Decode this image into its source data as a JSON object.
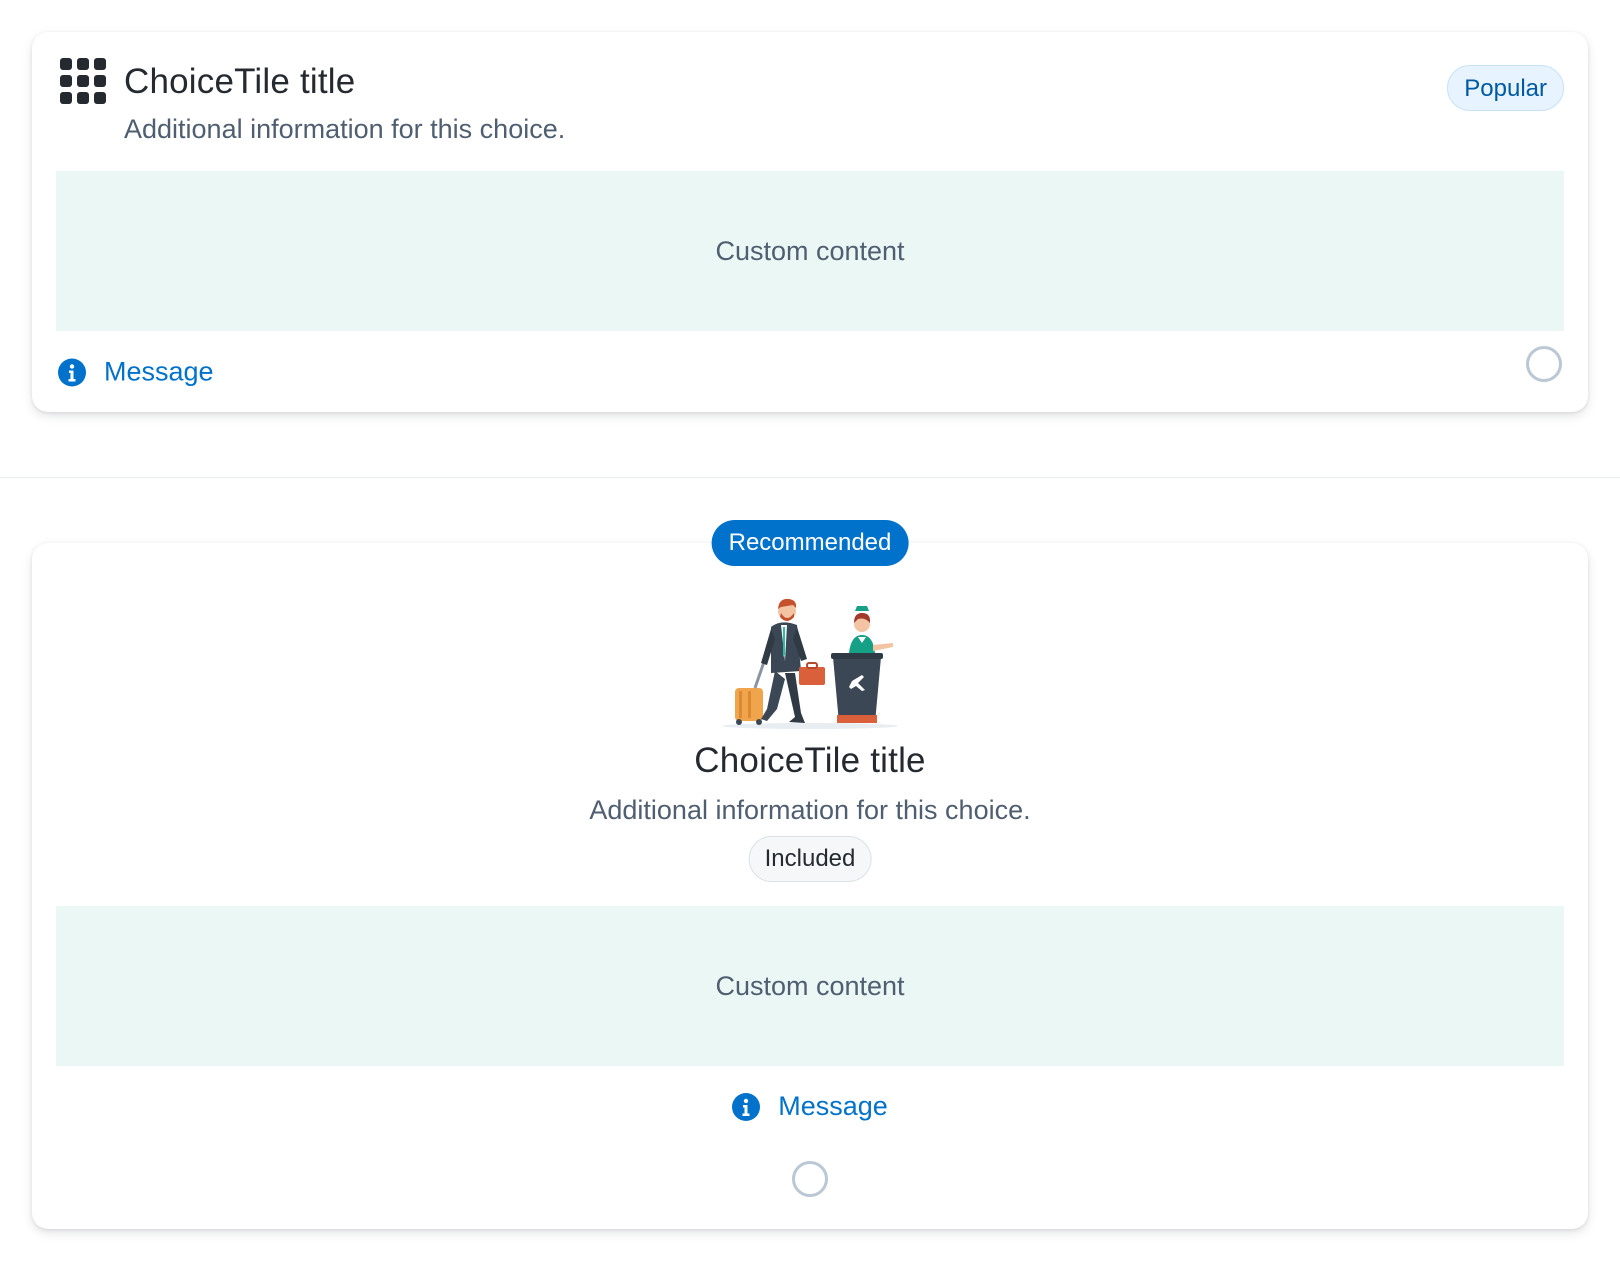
{
  "tile_top": {
    "icon": "apps-grid-icon",
    "title": "ChoiceTile title",
    "description": "Additional information for this choice.",
    "badge": "Popular",
    "custom_content": "Custom content",
    "message": "Message",
    "message_icon": "info-icon",
    "selected": false
  },
  "tile_bottom": {
    "badge": "Recommended",
    "illustration": "airport-check-in-illustration",
    "title": "ChoiceTile title",
    "description": "Additional information for this choice.",
    "tag": "Included",
    "custom_content": "Custom content",
    "message": "Message",
    "message_icon": "info-icon",
    "selected": false
  },
  "colors": {
    "primary": "#0172cb",
    "popular_badge_bg": "#e7f3ff",
    "custom_content_bg": "#ebf7f4",
    "title": "#252a31",
    "secondary_text": "#4f5e71",
    "radio_border": "#bac7d5"
  }
}
